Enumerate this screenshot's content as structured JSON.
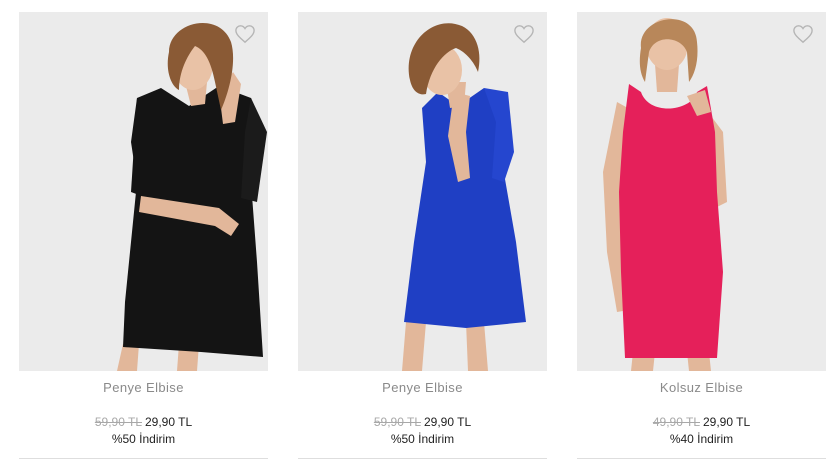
{
  "products": [
    {
      "name": "Penye Elbise",
      "old_price": "59,90 TL",
      "new_price": "29,90 TL",
      "discount": "%50 İndirim",
      "dress_color": "#141414",
      "style": "sleeved-aline"
    },
    {
      "name": "Penye Elbise",
      "old_price": "59,90 TL",
      "new_price": "29,90 TL",
      "discount": "%50 İndirim",
      "dress_color": "#1f3fc4",
      "style": "sleeved-aline"
    },
    {
      "name": "Kolsuz Elbise",
      "old_price": "49,90 TL",
      "new_price": "29,90 TL",
      "discount": "%40 İndirim",
      "dress_color": "#e5205a",
      "style": "sleeveless-bodycon"
    }
  ],
  "colors": {
    "background": "#ffffff",
    "photo_bg": "#ebebeb",
    "name_text": "#8a8a8a",
    "old_price_text": "#a8a8a8",
    "price_text": "#222222",
    "skin": "#e9c2a6",
    "hair_brown": "#8a5a35",
    "hair_blonde": "#b8875a"
  },
  "icons": {
    "favorite": "heart-outline-icon"
  }
}
